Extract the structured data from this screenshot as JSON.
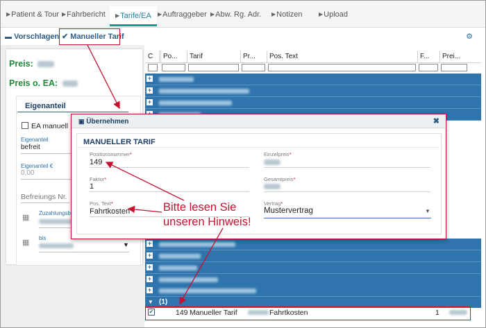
{
  "tabs": {
    "items": [
      {
        "label": "Patient & Tour"
      },
      {
        "label": "Fahrbericht"
      },
      {
        "label": "Tarife/EA"
      },
      {
        "label": "Auftraggeber"
      },
      {
        "label": "Abw. Rg. Adr."
      },
      {
        "label": "Notizen"
      },
      {
        "label": "Upload"
      }
    ],
    "active": "Tarife/EA"
  },
  "toolbar": {
    "vorschlagen_label": "Vorschlagen",
    "manuell_label": "Manueller Tarif"
  },
  "left": {
    "preis_label": "Preis:",
    "preis_oea_label": "Preis o. EA:",
    "eigenanteil_title": "Eigenanteil",
    "ea_manuell_label": "EA manuell",
    "eigenanteil_small": "Eigenanteil",
    "eigenanteil_value": "befreit",
    "eigenanteil_eur_small": "Eigenanteil €",
    "eigenanteil_eur_value": "0,00",
    "befreiungs_label": "Befreiungs Nr.",
    "zuzahlung_small": "Zuzahlungsbe",
    "bis_small": "bis"
  },
  "grid": {
    "headers": [
      "C",
      "Po...",
      "Tarif",
      "Pr...",
      "Pos. Text",
      "F...",
      "Prei..."
    ],
    "group_label": "(1)",
    "selected_row": {
      "pos": "149",
      "tarif": "Manueller Tarif",
      "text": "Fahrtkosten",
      "faktor": "1"
    }
  },
  "modal": {
    "title": "Übernehmen",
    "section_title": "MANUELLER TARIF",
    "fields": {
      "positionsnummer_label": "Positionsnummer",
      "positionsnummer_value": "149",
      "faktor_label": "Faktor",
      "faktor_value": "1",
      "postext_label": "Pos. Text",
      "postext_value": "Fahrtkosten",
      "einzelpreis_label": "Einzelpreis",
      "gesamtpreis_label": "Gesamtpreis",
      "vertrag_label": "Vertrag",
      "vertrag_value": "Mustervertrag"
    }
  },
  "annotation": {
    "line1": "Bitte lesen Sie",
    "line2": "unseren Hinweis!"
  },
  "colors": {
    "accent": "#12a08c",
    "link_blue": "#2c5e8a",
    "grid_row": "#2f74ad",
    "price_green": "#1f8a3a",
    "highlight_red": "#c8102e"
  },
  "icons": {
    "tab_arrow": "caret-right-icon",
    "vorschlagen": "book-icon",
    "manuell": "check-icon",
    "settings": "gear-icon",
    "modal": "save-icon",
    "close": "close-icon",
    "calendar": "calendar-icon",
    "expand": "plus-box-icon",
    "dropdown": "caret-down-icon"
  }
}
